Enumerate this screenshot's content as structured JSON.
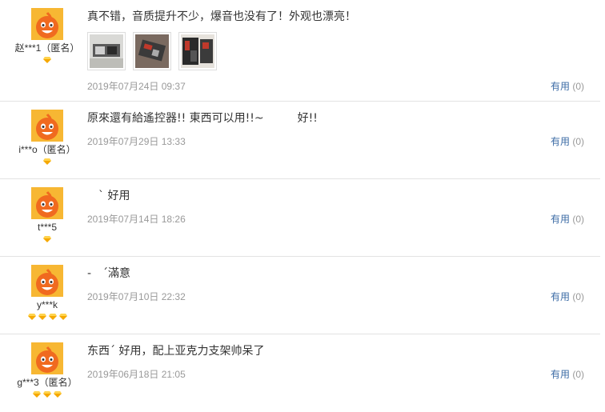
{
  "useful_label": "有用",
  "reviews": [
    {
      "user": "赵***1（匿名）",
      "level": 1,
      "text": "真不错，音质提升不少，爆音也没有了！外观也漂亮！",
      "date": "2019年07月24日 09:37",
      "useful_count": "(0)"
    },
    {
      "user": "i***o（匿名）",
      "level": 1,
      "text": "原來還有給遙控器!! 東西可以用!!~　　　好!!",
      "date": "2019年07月29日 13:33",
      "useful_count": "(0)"
    },
    {
      "user": "t***5",
      "level": 1,
      "text": "　ˋ 好用",
      "date": "2019年07月14日 18:26",
      "useful_count": "(0)"
    },
    {
      "user": "y***k",
      "level": 4,
      "text": "-　ˊ滿意",
      "date": "2019年07月10日 22:32",
      "useful_count": "(0)"
    },
    {
      "user": "g***3（匿名）",
      "level": 3,
      "text": "东西ˊ 好用，配上亚克力支架帅呆了",
      "date": "2019年06月18日 21:05",
      "useful_count": "(0)"
    }
  ],
  "colors": {
    "link": "#3d6ca6",
    "meta": "#999999",
    "avatar_bg": "#f7b733",
    "avatar_face": "#f06a1f",
    "diamond": "#f5a800"
  }
}
